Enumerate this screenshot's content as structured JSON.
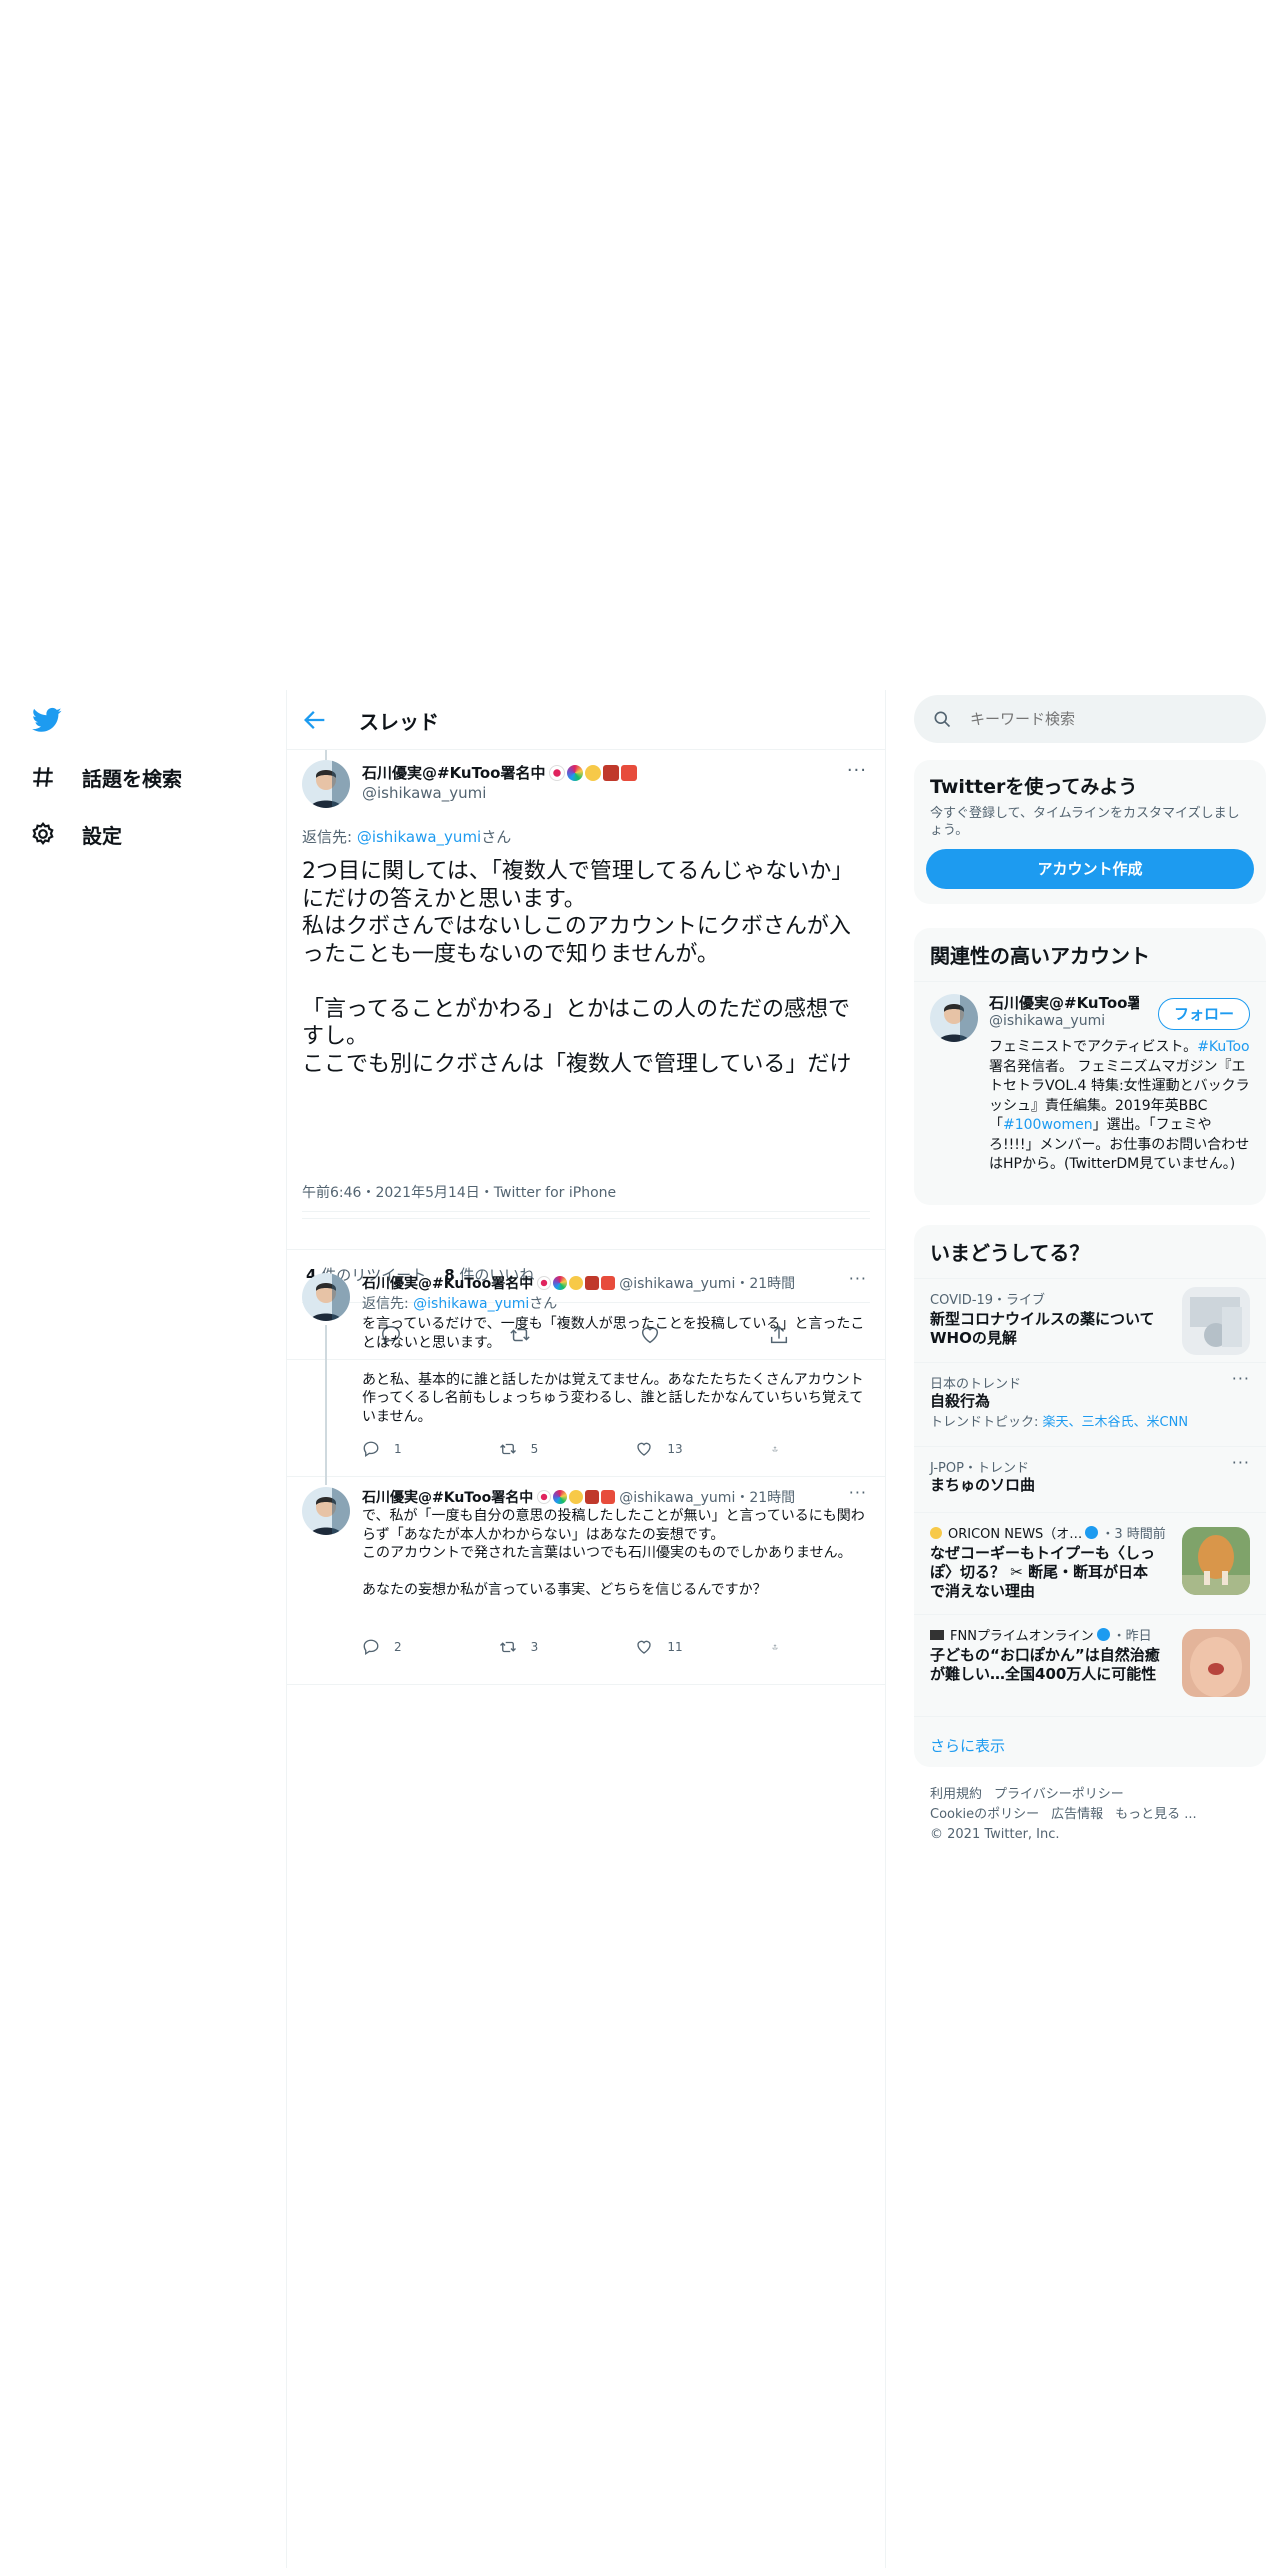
{
  "nav": {
    "explore": "話題を検索",
    "settings": "設定"
  },
  "header": {
    "title": "スレッド"
  },
  "focus_tweet": {
    "name": "石川優実@#KuToo署名中",
    "handle": "@ishikawa_yumi",
    "reply_prefix": "返信先: ",
    "reply_handle": "@ishikawa_yumi",
    "reply_suffix": "さん",
    "text": "2つ目に関しては、「複数人で管理してるんじゃないか」にだけの答えかと思います。\n私はクボさんではないしこのアカウントにクボさんが入ったことも一度もないので知りませんが。\n\n「言ってることがかわる」とかはこの人のただの感想ですし。\nここでも別にクボさんは「複数人で管理している」だけ",
    "meta": "午前6:46・2021年5月14日・Twitter for iPhone",
    "retweets_count": "4",
    "retweets_label": " 件のリツイート",
    "likes_count": "8",
    "likes_label": " 件のいいね"
  },
  "replies": [
    {
      "name": "石川優実@#KuToo署名中",
      "handle_time": "@ishikawa_yumi・21時間",
      "reply_prefix": "返信先: ",
      "reply_handle": "@ishikawa_yumi",
      "reply_suffix": "さん",
      "text": "を言っているだけで、一度も「複数人が思ったことを投稿している」と言ったことはないと思います。\n\nあと私、基本的に誰と話したかは覚えてません。あなたたちたくさんアカウント作ってくるし名前もしょっちゅう変わるし、誰と話したかなんていちいち覚えていません。",
      "replies": "1",
      "retweets": "5",
      "likes": "13"
    },
    {
      "name": "石川優実@#KuToo署名中",
      "handle_time": "@ishikawa_yumi・21時間",
      "text": "で、私が「一度も自分の意思の投稿したしたことが無い」と言っているにも関わらず「あなたが本人かわからない」はあなたの妄想です。\nこのアカウントで発された言葉はいつでも石川優実のものでしかありません。\n\nあなたの妄想か私が言っている事実、どちらを信じるんですか？",
      "replies": "2",
      "retweets": "3",
      "likes": "11"
    }
  ],
  "sidebar": {
    "search_placeholder": "キーワード検索",
    "signup": {
      "title": "Twitterを使ってみよう",
      "desc": "今すぐ登録して、タイムラインをカスタマイズしましょう。",
      "button": "アカウント作成"
    },
    "related": {
      "title": "関連性の高いアカウント",
      "name": "石川優実@#KuToo署...",
      "handle": "@ishikawa_yumi",
      "follow": "フォロー",
      "bio_1": "フェミニストでアクティビスト。",
      "bio_tag1": "#KuToo",
      "bio_2": " 署名発信者。 フェミニズムマガジン『エトセトラVOL.4 特集:女性運動とバックラッシュ』責任編集。2019年英BBC 「",
      "bio_tag2": "#100women",
      "bio_3": "」選出。「フェミやろ!!!!」メンバー。お仕事のお問い合わせはHPから。(TwitterDM見ていません。)"
    },
    "trends_title": "いまどうしてる？",
    "trends": [
      {
        "context": "COVID-19・ライブ",
        "title": "新型コロナウイルスの薬について WHOの見解"
      },
      {
        "context": "日本のトレンド",
        "title": "自殺行為",
        "sub_prefix": "トレンドトピック: ",
        "sub_links": "楽天、三木谷氏、米CNN"
      },
      {
        "context": "J-POP・トレンド",
        "title": "まちゅのソロ曲"
      },
      {
        "context_source": "ORICON NEWS（オ…",
        "context_time": "・3 時間前",
        "title": "なぜコーギーもトイプーも〈しっぽ〉切る？ ✂ 断尾・断耳が日本で消えない理由"
      },
      {
        "context_source": "FNNプライムオンライン",
        "context_time": "・昨日",
        "title": "子どもの“お口ぽかん”は自然治癒が難しい…全国400万人に可能性"
      }
    ],
    "show_more": "さらに表示",
    "footer": {
      "terms": "利用規約",
      "privacy": "プライバシーポリシー",
      "cookie": "Cookieのポリシー",
      "ads": "広告情報",
      "more": "もっと見る ...",
      "copyright": "© 2021 Twitter, Inc."
    }
  },
  "colors": {
    "accent": "#1d9bf0",
    "text": "#0f1419",
    "muted": "#536471",
    "border": "#eff3f4",
    "card_bg": "#f7f9f9"
  }
}
